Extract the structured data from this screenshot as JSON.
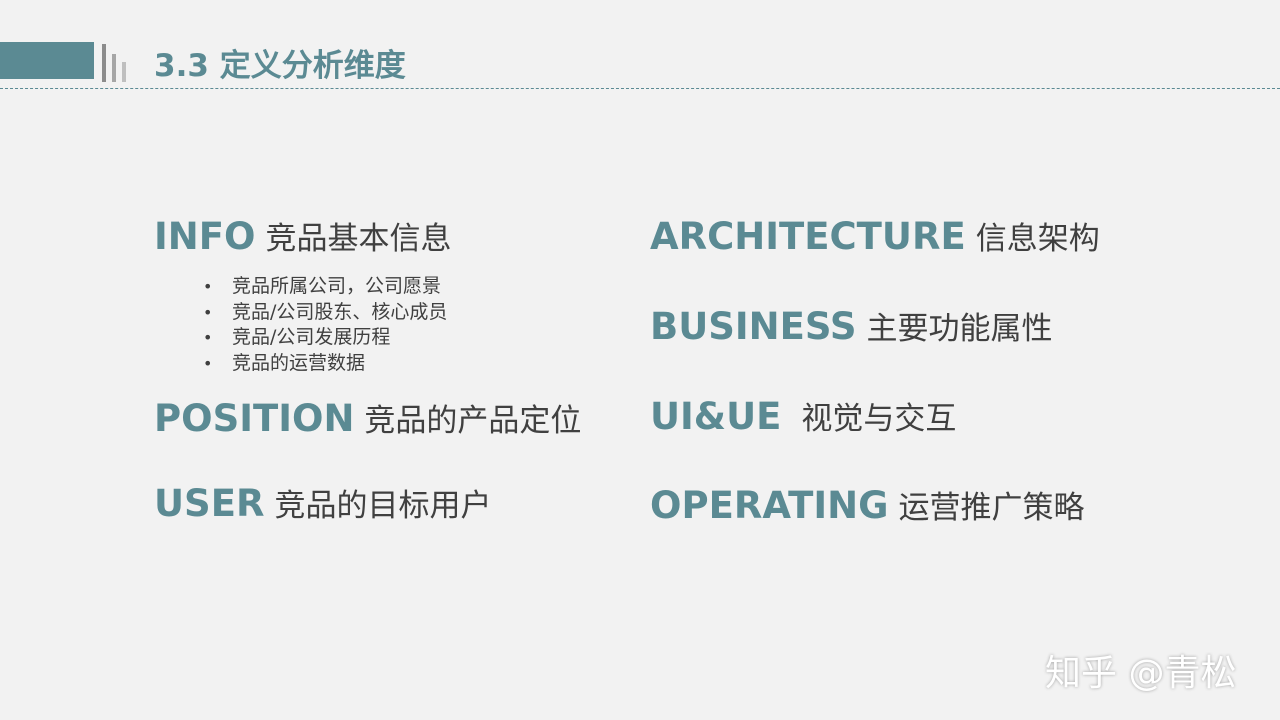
{
  "slide": {
    "title": "3.3 定义分析维度",
    "accent_color": "#5b8a93"
  },
  "sections": {
    "info": {
      "en": "INFO",
      "cn": "竞品基本信息"
    },
    "position": {
      "en": "POSITION",
      "cn": "竞品的产品定位"
    },
    "user": {
      "en": "USER",
      "cn": "竞品的目标用户"
    },
    "architecture": {
      "en": "ARCHITECTURE",
      "cn": "信息架构"
    },
    "business": {
      "en": "BUSINESS",
      "cn": "主要功能属性"
    },
    "uiue": {
      "en": "UI&UE",
      "cn": "视觉与交互"
    },
    "operating": {
      "en": "OPERATING",
      "cn": "运营推广策略"
    }
  },
  "info_bullets": [
    "竞品所属公司，公司愿景",
    "竞品/公司股东、核心成员",
    "竞品/公司发展历程",
    "竞品的运营数据"
  ],
  "watermark": "知乎 @青松"
}
